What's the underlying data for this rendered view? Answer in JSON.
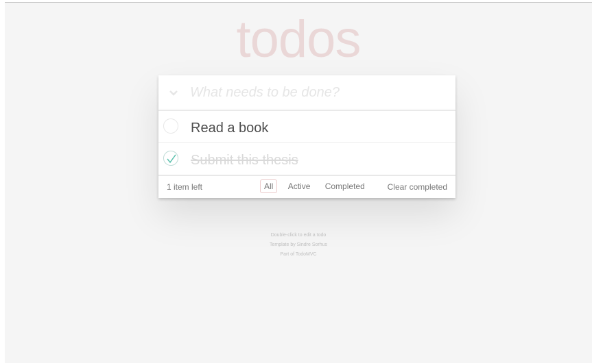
{
  "app": {
    "title": "todos"
  },
  "new_todo": {
    "placeholder": "What needs to be done?",
    "toggle_icon": "chevron-down-icon"
  },
  "todos": [
    {
      "label": "Read a book",
      "completed": false
    },
    {
      "label": "Submit this thesis",
      "completed": true
    }
  ],
  "footer": {
    "count_text": "1 item left",
    "filters": [
      "All",
      "Active",
      "Completed"
    ],
    "selected_filter": "All",
    "clear_label": "Clear completed"
  },
  "info": {
    "line1": "Double-click to edit a todo",
    "line2": "Template by Sindre Sorhus",
    "line3": "Part of TodoMVC"
  },
  "colors": {
    "title": "#efd5d5",
    "check_accent": "#5dc2af",
    "background": "#f5f5f5"
  }
}
